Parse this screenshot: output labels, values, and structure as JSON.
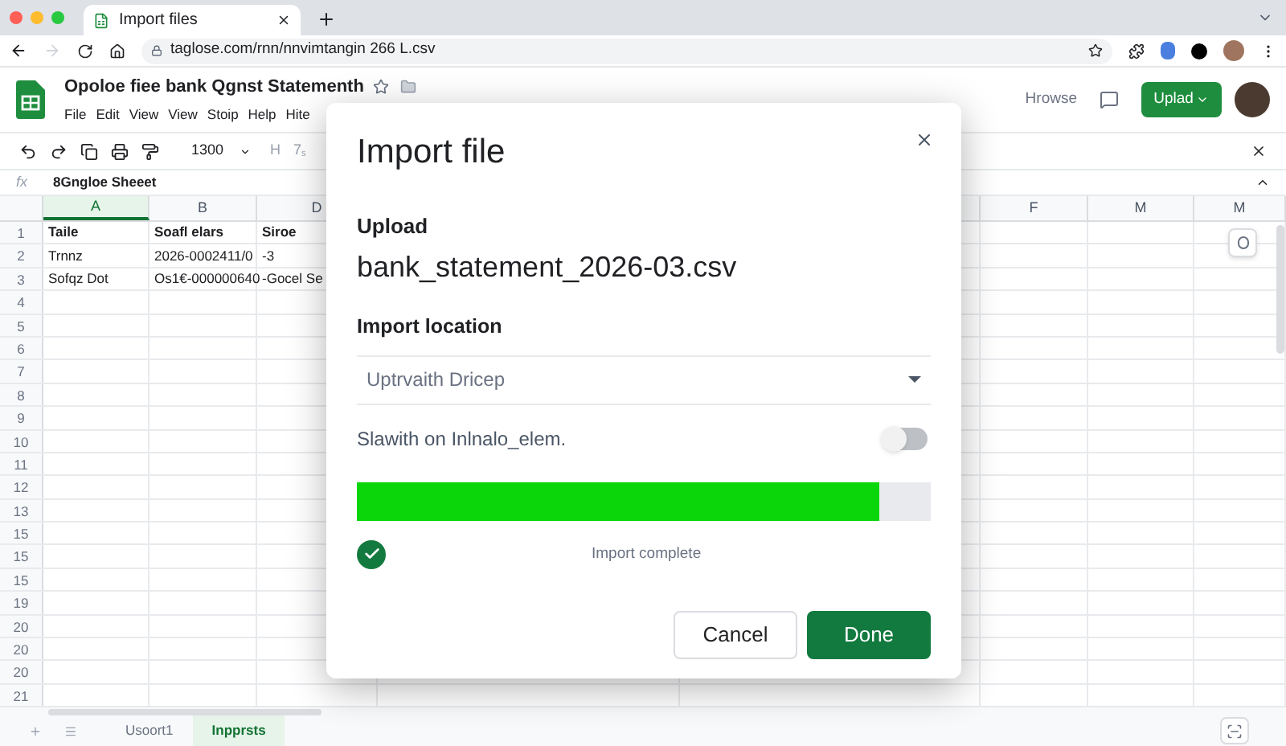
{
  "browser": {
    "tab_title": "Import files",
    "url": "taglose.com/rnn/nnvimtangin 266 L.csv"
  },
  "document": {
    "title": "Opoloe fiee bank Qgnst Statementh",
    "menu": [
      "File",
      "Edit",
      "View",
      "View",
      "Stoip",
      "Help",
      "Hite"
    ],
    "browse_label": "Hrowse",
    "upload_button": "Uplad"
  },
  "toolbar": {
    "zoom": "1300",
    "items": [
      "H",
      "7ₛ"
    ]
  },
  "formula_bar": {
    "fx": "fx",
    "value": "8Gngloe Sheeet"
  },
  "grid": {
    "columns": [
      {
        "label": "A",
        "selected": true
      },
      {
        "label": "B",
        "selected": false
      },
      {
        "label": "D",
        "selected": false
      },
      {
        "label": "F",
        "selected": false
      },
      {
        "label": "M",
        "selected": false
      },
      {
        "label": "M",
        "selected": false
      }
    ],
    "rows": [
      {
        "label": "1",
        "cells": [
          "Taile",
          "Soafl elars",
          "Siroe"
        ]
      },
      {
        "label": "2",
        "cells": [
          "Trnnz",
          "2026-0002411/0",
          "-3"
        ]
      },
      {
        "label": "3",
        "cells": [
          "Sofqz Dot",
          "Os1€-000000640",
          "-Gocel Se"
        ]
      },
      {
        "label": "4",
        "cells": []
      },
      {
        "label": "5",
        "cells": []
      },
      {
        "label": "6",
        "cells": []
      },
      {
        "label": "7",
        "cells": []
      },
      {
        "label": "8",
        "cells": []
      },
      {
        "label": "9",
        "cells": []
      },
      {
        "label": "10",
        "cells": []
      },
      {
        "label": "11",
        "cells": []
      },
      {
        "label": "12",
        "cells": []
      },
      {
        "label": "13",
        "cells": []
      },
      {
        "label": "15",
        "cells": []
      },
      {
        "label": "15",
        "cells": []
      },
      {
        "label": "15",
        "cells": []
      },
      {
        "label": "19",
        "cells": []
      },
      {
        "label": "20",
        "cells": []
      },
      {
        "label": "20",
        "cells": []
      },
      {
        "label": "20",
        "cells": []
      },
      {
        "label": "21",
        "cells": []
      }
    ]
  },
  "sheet_tabs": [
    {
      "label": "Usoort1",
      "selected": false
    },
    {
      "label": "Inpprsts",
      "selected": true
    }
  ],
  "dialog": {
    "title": "Import file",
    "upload_label": "Upload",
    "file_name": "bank_statement_2026-03.csv",
    "location_label": "Import location",
    "location_value": "Uptrvaith Dricep",
    "toggle": {
      "label": "Slawith on Inlnalo_elem.",
      "on": false
    },
    "progress": {
      "level": 0.91
    },
    "status": "Import complete",
    "buttons": [
      {
        "label": "Cancel",
        "kind": "secondary"
      },
      {
        "label": "Done",
        "kind": "primary"
      }
    ]
  }
}
